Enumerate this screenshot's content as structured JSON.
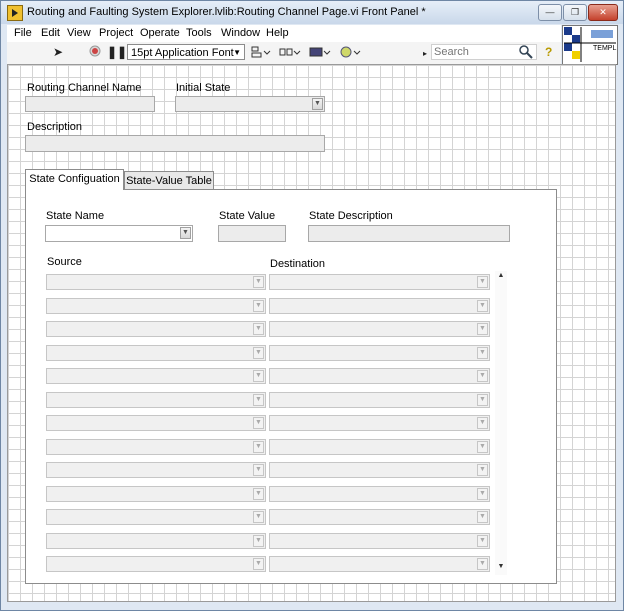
{
  "window": {
    "title": "Routing and Faulting System Explorer.lvlib:Routing Channel Page.vi Front Panel *",
    "minimize_icon": "minimize-icon",
    "restore_icon": "restore-icon",
    "close_icon": "close-icon"
  },
  "menu": [
    "File",
    "Edit",
    "View",
    "Project",
    "Operate",
    "Tools",
    "Window",
    "Help"
  ],
  "toolbar": {
    "font": "15pt Application Font",
    "search_placeholder": "Search",
    "icons": [
      "run-arrow-icon",
      "abort-icon",
      "pause-icon",
      "align-objects-icon",
      "distribute-objects-icon",
      "resize-objects-icon",
      "reorder-icon",
      "search-icon",
      "context-help-icon"
    ]
  },
  "vi_icon": {
    "text": "TEMPL"
  },
  "panel": {
    "routing_channel_name_label": "Routing Channel Name",
    "initial_state_label": "Initial State",
    "description_label": "Description",
    "tabs": [
      "State Configuation",
      "State-Value Table"
    ],
    "active_tab": "State Configuation",
    "state_name_label": "State Name",
    "state_value_label": "State Value",
    "state_description_label": "State Description",
    "source_label": "Source",
    "destination_label": "Destination",
    "row_count": 13
  }
}
